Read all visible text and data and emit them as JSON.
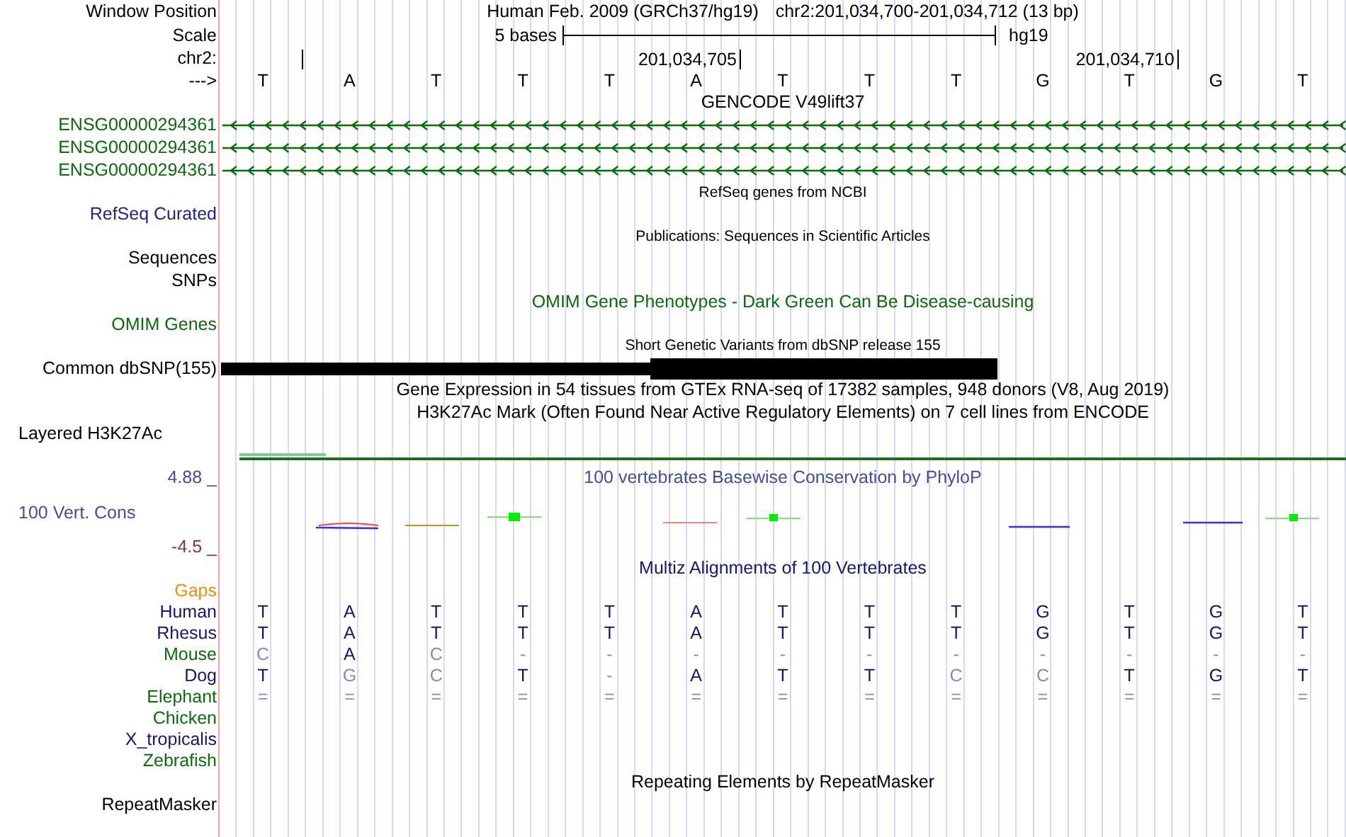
{
  "position_row": {
    "label": "Window Position",
    "assembly": "Human Feb. 2009 (GRCh37/hg19)",
    "range": "chr2:201,034,700-201,034,712 (13 bp)"
  },
  "scale_row": {
    "label": "Scale",
    "span": "5 bases",
    "assembly": "hg19"
  },
  "ruler_row": {
    "label": "chr2:",
    "ticks": [
      "201,034,705",
      "201,034,710"
    ]
  },
  "sequence_row": {
    "label": "--->",
    "bases": [
      "T",
      "A",
      "T",
      "T",
      "T",
      "A",
      "T",
      "T",
      "T",
      "G",
      "T",
      "G",
      "T"
    ]
  },
  "tracks": [
    {
      "kind": "heading",
      "text": "GENCODE V49lift37",
      "color": "#000000"
    },
    {
      "kind": "gene",
      "label": "ENSG00000294361",
      "color": "#0b6b0b"
    },
    {
      "kind": "gene",
      "label": "ENSG00000294361",
      "color": "#0b6b0b"
    },
    {
      "kind": "gene",
      "label": "ENSG00000294361",
      "color": "#0b6b0b"
    },
    {
      "kind": "caption",
      "text": "RefSeq genes from NCBI",
      "color": "#000000"
    },
    {
      "kind": "label",
      "label": "RefSeq Curated",
      "color": "#22228c"
    },
    {
      "kind": "caption",
      "text": "Publications: Sequences in Scientific Articles",
      "color": "#000000"
    },
    {
      "kind": "label",
      "label": "Sequences",
      "color": "#000000"
    },
    {
      "kind": "label",
      "label": "SNPs",
      "color": "#000000"
    },
    {
      "kind": "heading",
      "text": "OMIM Gene Phenotypes - Dark Green Can Be Disease-causing",
      "color": "#0b6b0b"
    },
    {
      "kind": "label",
      "label": "OMIM Genes",
      "color": "#0b6b0b"
    },
    {
      "kind": "caption",
      "text": "Short Genetic Variants from dbSNP release 155",
      "color": "#000000"
    },
    {
      "kind": "snp",
      "label": "Common dbSNP(155)",
      "color": "#000000"
    },
    {
      "kind": "heading",
      "text": "Gene Expression in 54 tissues from GTEx RNA-seq of 17382 samples, 948 donors (V8, Aug 2019)",
      "color": "#000000"
    },
    {
      "kind": "heading",
      "text": "H3K27Ac Mark (Often Found Near Active Regulatory Elements) on 7 cell lines from ENCODE",
      "color": "#000000"
    },
    {
      "kind": "signal",
      "label": "Layered H3K27Ac",
      "color": "#000000"
    },
    {
      "kind": "conservation",
      "label": "100 Vert. Cons",
      "max": "4.88 _",
      "min": "-4.5 _",
      "title": "100 vertebrates Basewise Conservation by PhyloP",
      "color": "#4a4a9a"
    },
    {
      "kind": "heading",
      "text": "Multiz Alignments of 100 Vertebrates",
      "color": "#16166e"
    },
    {
      "kind": "label",
      "label": "Gaps",
      "color": "#e8900a"
    },
    {
      "kind": "alignment",
      "label": "Human",
      "color": "#16166e",
      "bases": [
        "T",
        "A",
        "T",
        "T",
        "T",
        "A",
        "T",
        "T",
        "T",
        "G",
        "T",
        "G",
        "T"
      ],
      "conserved": [
        true,
        true,
        true,
        true,
        true,
        true,
        true,
        true,
        true,
        true,
        true,
        true,
        true
      ]
    },
    {
      "kind": "alignment",
      "label": "Rhesus",
      "color": "#16166e",
      "bases": [
        "T",
        "A",
        "T",
        "T",
        "T",
        "A",
        "T",
        "T",
        "T",
        "G",
        "T",
        "G",
        "T"
      ],
      "conserved": [
        true,
        true,
        true,
        true,
        true,
        true,
        true,
        true,
        true,
        true,
        true,
        true,
        true
      ]
    },
    {
      "kind": "alignment",
      "label": "Mouse",
      "color": "#0b6b0b",
      "bases": [
        "C",
        "A",
        "C",
        "-",
        "-",
        "-",
        "-",
        "-",
        "-",
        "-",
        "-",
        "-",
        "-"
      ],
      "conserved": [
        false,
        true,
        false,
        false,
        false,
        false,
        false,
        false,
        false,
        false,
        false,
        false,
        false
      ]
    },
    {
      "kind": "alignment",
      "label": "Dog",
      "color": "#16166e",
      "bases": [
        "T",
        "G",
        "C",
        "T",
        "-",
        "A",
        "T",
        "T",
        "C",
        "C",
        "T",
        "G",
        "T"
      ],
      "conserved": [
        true,
        false,
        false,
        true,
        false,
        true,
        true,
        true,
        false,
        false,
        true,
        true,
        true
      ]
    },
    {
      "kind": "alignment",
      "label": "Elephant",
      "color": "#0b6b0b",
      "bases": [
        "=",
        "=",
        "=",
        "=",
        "=",
        "=",
        "=",
        "=",
        "=",
        "=",
        "=",
        "=",
        "="
      ],
      "conserved": [
        false,
        false,
        false,
        false,
        false,
        false,
        false,
        false,
        false,
        false,
        false,
        false,
        false
      ]
    },
    {
      "kind": "alignment",
      "label": "Chicken",
      "color": "#0b6b0b"
    },
    {
      "kind": "alignment",
      "label": "X_tropicalis",
      "color": "#16166e"
    },
    {
      "kind": "alignment",
      "label": "Zebrafish",
      "color": "#0b6b0b"
    },
    {
      "kind": "heading",
      "text": "Repeating Elements by RepeatMasker",
      "color": "#000000"
    },
    {
      "kind": "label",
      "label": "RepeatMasker",
      "color": "#000000"
    }
  ]
}
